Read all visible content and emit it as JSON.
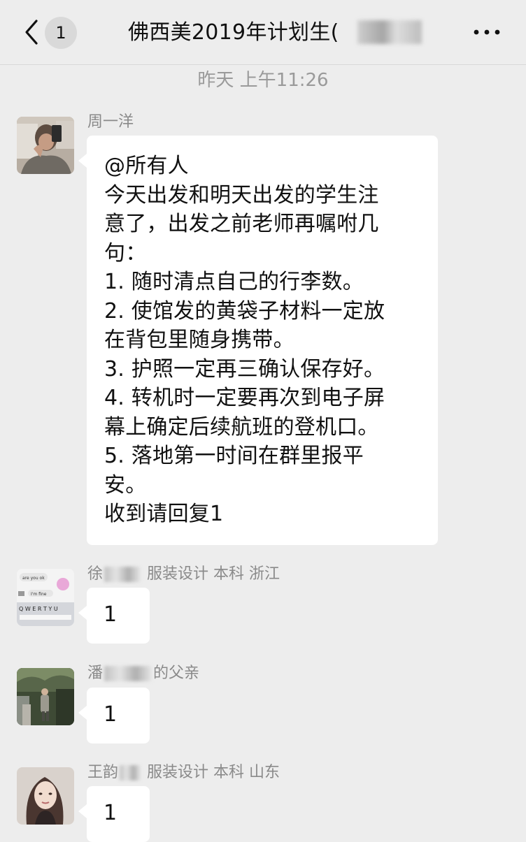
{
  "nav": {
    "back_icon": "chevron-left-icon",
    "unread_count": "1",
    "title": "佛西美2019年计划生(",
    "more_icon": "more-dots-icon"
  },
  "timestamp": "昨天 上午11:26",
  "messages": [
    {
      "sender": "周一洋",
      "lines": [
        "@所有人",
        "今天出发和明天出发的学生注",
        "意了，出发之前老师再嘱咐几",
        "句：",
        "1. 随时清点自己的行李数。",
        "2. 使馆发的黄袋子材料一定放",
        "在背包里随身携带。",
        "3. 护照一定再三确认保存好。",
        "4. 转机时一定要再次到电子屏",
        "幕上确定后续航班的登机口。",
        "5. 落地第一时间在群里报平",
        "安。",
        "收到请回复1"
      ]
    },
    {
      "sender_prefix": "徐",
      "sender_suffix": "服装设计 本科 浙江",
      "text": "1",
      "avatar_texts": [
        "are you ok",
        "I'm fine",
        "Q W E R T Y U"
      ]
    },
    {
      "sender_prefix": "潘",
      "sender_suffix": "的父亲",
      "text": "1"
    },
    {
      "sender_prefix": "王韵",
      "sender_suffix": "服装设计 本科 山东",
      "text": "1"
    }
  ],
  "colors": {
    "background": "#ededed",
    "bubble": "#ffffff",
    "name": "#8a8a8a",
    "timestamp": "#9a9a9a"
  }
}
